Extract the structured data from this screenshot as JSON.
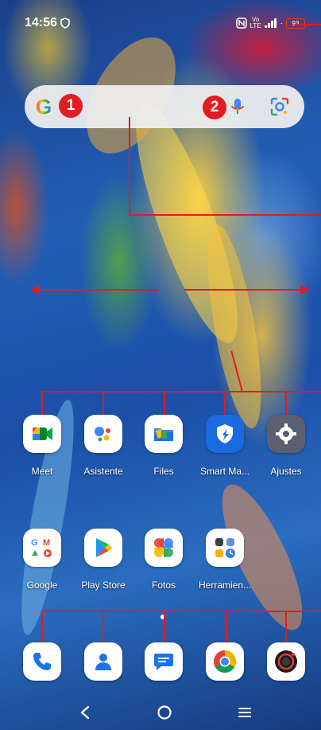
{
  "status_bar": {
    "time": "14:56",
    "network_vo": "Vo",
    "network_lte": "LTE",
    "battery": "93"
  },
  "search_bar": {
    "google_letter": "G",
    "badge_1": "1",
    "badge_2": "2"
  },
  "apps_row1": [
    {
      "label": "Meet"
    },
    {
      "label": "Asistente"
    },
    {
      "label": "Files"
    },
    {
      "label": "Smart Ma..."
    },
    {
      "label": "Ajustes"
    }
  ],
  "apps_row2": [
    {
      "label": "Google"
    },
    {
      "label": "Play Store"
    },
    {
      "label": "Fotos"
    },
    {
      "label": "Herramien..."
    }
  ],
  "dock": [
    {
      "icon": "phone-icon"
    },
    {
      "icon": "contacts-icon"
    },
    {
      "icon": "messages-icon"
    },
    {
      "icon": "chrome-icon"
    },
    {
      "icon": "camera-icon"
    }
  ],
  "colors": {
    "annotation_red": "#e21c20",
    "search_bg": "#f0f0f0"
  }
}
